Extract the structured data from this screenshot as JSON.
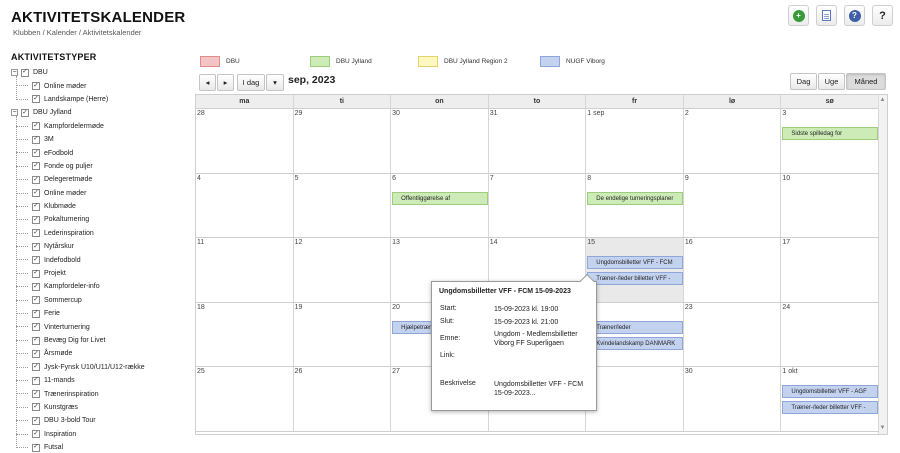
{
  "header": {
    "title": "AKTIVITETSKALENDER",
    "breadcrumb": "Klubben / Kalender / Aktivitetskalender",
    "actions": [
      {
        "name": "add-button",
        "icon": "plus-circle-icon"
      },
      {
        "name": "document-button",
        "icon": "document-icon"
      },
      {
        "name": "help-circle-button",
        "icon": "question-circle-icon"
      },
      {
        "name": "help-button",
        "icon": "question-icon",
        "glyph": "?"
      }
    ]
  },
  "sidebar": {
    "title": "AKTIVITETSTYPER",
    "groups": [
      {
        "label": "DBU",
        "expander": "−",
        "children": [
          "Online møder",
          "Landskampe (Herre)"
        ]
      },
      {
        "label": "DBU Jylland",
        "expander": "−",
        "children": [
          "Kampfordelermøde",
          "3M",
          "eFodbold",
          "Fonde og puljer",
          "Delegeretmøde",
          "Online møder",
          "Klubmøde",
          "Pokalturnering",
          "Lederinspiration",
          "Nytårskur",
          "Indefodbold",
          "Projekt",
          "Kampfordeler-info",
          "Sommercup",
          "Ferie",
          "Vinterturnering",
          "Bevæg Dig for Livet",
          "Årsmøde",
          "Jysk-Fynsk U10/U11/U12-række",
          "11-mands",
          "Trænerinspiration",
          "Kunstgræs",
          "DBU 3-bold Tour",
          "Inspiration",
          "Futsal"
        ]
      }
    ],
    "check_glyph": "✓"
  },
  "legend": [
    {
      "label": "DBU",
      "color": "#f4c4c4",
      "border": "#dd8d8d"
    },
    {
      "label": "DBU Jylland",
      "color": "#cdebb7",
      "border": "#9ccc7c"
    },
    {
      "label": "DBU Jylland Region 2",
      "color": "#fff7c0",
      "border": "#e6d46a"
    },
    {
      "label": "NUGF Viborg",
      "color": "#c3d3ef",
      "border": "#8ea7d8"
    }
  ],
  "toolbar": {
    "prev": "◂",
    "next": "▸",
    "today": "I dag",
    "dropdown": "▾",
    "month_title": "sep, 2023",
    "views": [
      "Dag",
      "Uge",
      "Måned"
    ],
    "active_view": "Måned"
  },
  "calendar": {
    "weekdays": [
      "ma",
      "ti",
      "on",
      "to",
      "fr",
      "lø",
      "sø"
    ],
    "weeks": [
      [
        "28",
        "29",
        "30",
        "31",
        "1 sep",
        "2",
        "3"
      ],
      [
        "4",
        "5",
        "6",
        "7",
        "8",
        "9",
        "10"
      ],
      [
        "11",
        "12",
        "13",
        "14",
        "15",
        "16",
        "17"
      ],
      [
        "18",
        "19",
        "20",
        "21",
        "22",
        "23",
        "24"
      ],
      [
        "25",
        "26",
        "27",
        "28",
        "29",
        "30",
        "1 okt"
      ]
    ],
    "highlight_day": "15",
    "events": [
      {
        "week": 0,
        "day": 6,
        "slot": 0,
        "color": "green",
        "label": "Sidste spilledag for"
      },
      {
        "week": 1,
        "day": 2,
        "slot": 0,
        "color": "green",
        "label": "Offentliggørelse af"
      },
      {
        "week": 1,
        "day": 4,
        "slot": 0,
        "color": "green",
        "label": "De endelige turneringsplaner"
      },
      {
        "week": 2,
        "day": 4,
        "slot": 0,
        "color": "blue",
        "label": "Ungdomsbilletter VFF - FCM"
      },
      {
        "week": 2,
        "day": 4,
        "slot": 1,
        "color": "blue",
        "label": "Træner-/leder billetter VFF -"
      },
      {
        "week": 3,
        "day": 2,
        "slot": 0,
        "color": "blue",
        "label": "Hjælpetræner"
      },
      {
        "week": 3,
        "day": 4,
        "slot": 0,
        "color": "blue",
        "label": "Træner/leder"
      },
      {
        "week": 3,
        "day": 4,
        "slot": 1,
        "color": "blue",
        "label": "Kvindelandskamp DANMARK"
      },
      {
        "week": 4,
        "day": 6,
        "slot": 0,
        "color": "blue",
        "label": "Ungdomsbilletter VFF - AGF"
      },
      {
        "week": 4,
        "day": 6,
        "slot": 1,
        "color": "blue",
        "label": "Træner-/leder billetter VFF -"
      }
    ]
  },
  "popup": {
    "title": "Ungdomsbilletter VFF - FCM 15-09-2023",
    "start_label": "Start:",
    "start_value": "15-09-2023 kl. 19:00",
    "end_label": "Slut:",
    "end_value": "15-09-2023 kl. 21:00",
    "subject_label": "Emne:",
    "subject_value": "Ungdom - Medlemsbilletter Viborg FF Superligaen",
    "link_label": "Link:",
    "link_value": "",
    "desc_label": "Beskrivelse",
    "desc_value": "Ungdomsbilletter VFF - FCM 15-09-2023..."
  }
}
